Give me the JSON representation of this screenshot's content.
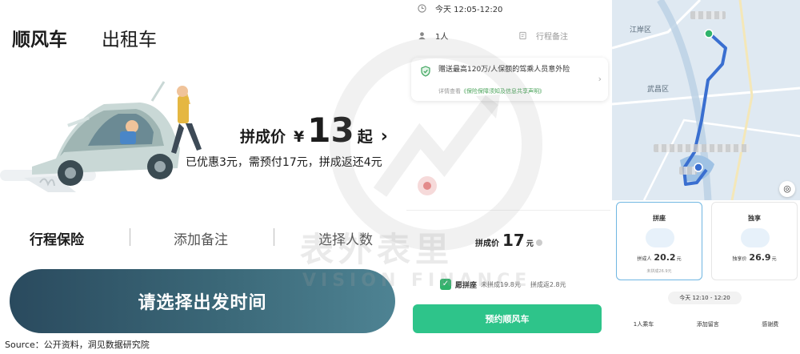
{
  "panel1": {
    "tabs": [
      "顺风车",
      "出租车"
    ],
    "price_label": "拼成价",
    "price_currency": "¥",
    "price_value": "13",
    "price_suffix": "起",
    "price_arrow": "›",
    "discount_text": "已优惠3元，需预付17元，拼成返还4元",
    "options": [
      "行程保险",
      "添加备注",
      "选择人数"
    ],
    "cta_label": "请选择出发时间"
  },
  "panel2": {
    "time_text": "今天 12:05-12:20",
    "people_text": "1人",
    "note_text": "行程备注",
    "insurance_text": "赠送最高120万/人保额的驾乘人员意外险",
    "insurance_sub_prefix": "详情查看",
    "insurance_sub_link": "《保险保障须知及信息共享声明》",
    "split_price_label": "拼成价",
    "split_price_value": "17",
    "split_price_unit": "元",
    "checkbox_label": "愿拼座",
    "not_split_text": "未拼成19.8元",
    "split_return_text": "拼成返2.8元",
    "book_button": "预约顺风车"
  },
  "panel3": {
    "map_labels": [
      "江岸区",
      "武昌区"
    ],
    "card_a": {
      "title": "拼座",
      "price_label": "拼成人",
      "price": "20.2",
      "unit": "元",
      "sub": "未拼成26.9元"
    },
    "card_b": {
      "title": "独享",
      "price_label": "独享价",
      "price": "26.9",
      "unit": "元"
    },
    "time_pill": "今天 12:10 - 12:20",
    "bottom_items": [
      "1人乘车",
      "添加留言",
      "感谢费"
    ]
  },
  "watermark": {
    "cn": "表外表里",
    "en": "VISION FINANCE"
  },
  "source": "Source：公开资料，洞见数据研究院",
  "colors": {
    "accent_green": "#2ec48a",
    "cta_dark": "#2a4a5e",
    "tab_highlight": "#fbe08a",
    "route_blue": "#3a6fd0"
  }
}
